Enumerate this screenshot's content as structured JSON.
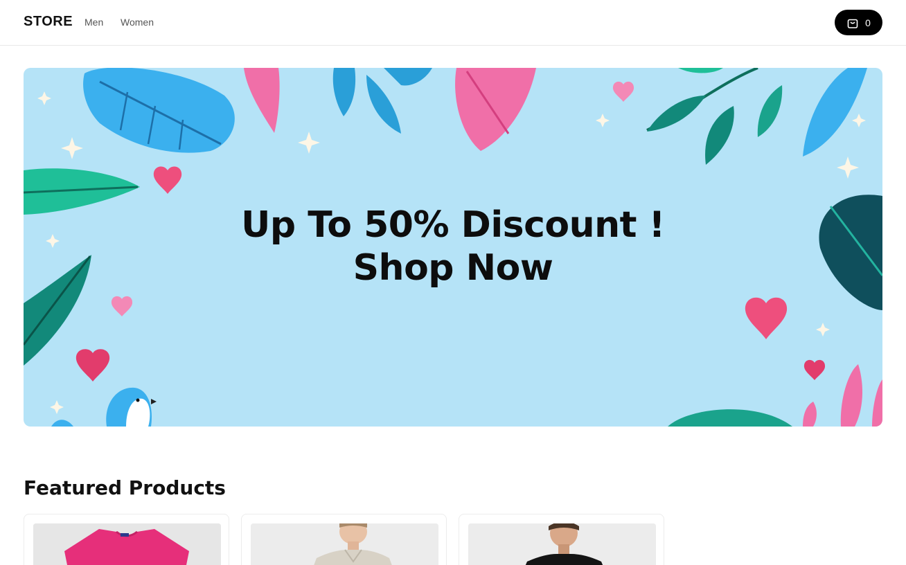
{
  "header": {
    "logo": "STORE",
    "nav": [
      {
        "label": "Men"
      },
      {
        "label": "Women"
      }
    ],
    "cart": {
      "icon": "shopping-bag-icon",
      "count": "0"
    }
  },
  "hero": {
    "line1": "Up To 50% Discount !",
    "line2": "Shop Now",
    "background_color": "#b5e3f7"
  },
  "featured": {
    "title": "Featured Products",
    "products": [
      {
        "image": "pink-tshirt"
      },
      {
        "image": "man-beige-shirt"
      },
      {
        "image": "man-black-tshirt"
      }
    ]
  },
  "colors": {
    "accent": "#000000",
    "leaf_blue": "#3bb0ee",
    "leaf_pink": "#f06fa8",
    "leaf_green": "#1aa38c",
    "heart": "#ee4f7d"
  }
}
